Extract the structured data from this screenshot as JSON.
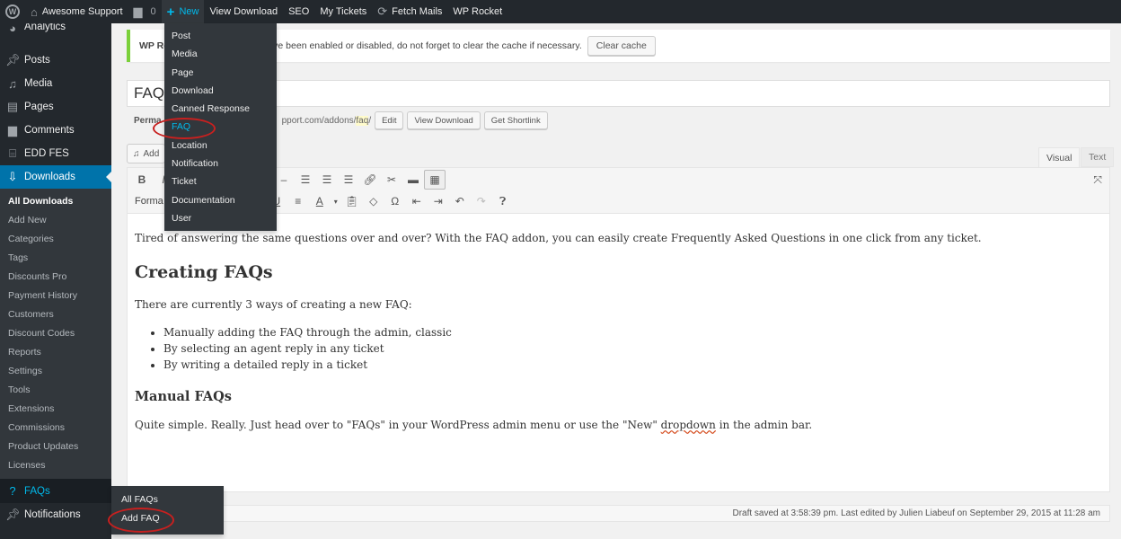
{
  "adminbar": {
    "site_name": "Awesome Support",
    "comment_count": "0",
    "new_label": "New",
    "items": [
      "View Download",
      "SEO",
      "My Tickets",
      "Fetch Mails",
      "WP Rocket"
    ]
  },
  "new_menu": {
    "items": [
      "Post",
      "Media",
      "Page",
      "Download",
      "Canned Response",
      "FAQ",
      "Location",
      "Notification",
      "Ticket",
      "Documentation",
      "User"
    ],
    "highlighted": "FAQ"
  },
  "sidebar": {
    "top_items": [
      {
        "label": "Analytics",
        "icon": "analytics-icon"
      },
      {
        "label": "Posts",
        "icon": "pin-icon"
      },
      {
        "label": "Media",
        "icon": "media-icon"
      },
      {
        "label": "Pages",
        "icon": "pages-icon"
      },
      {
        "label": "Comments",
        "icon": "comment-icon"
      },
      {
        "label": "EDD FES",
        "icon": "store-icon"
      },
      {
        "label": "Downloads",
        "icon": "download-icon"
      }
    ],
    "downloads_submenu": [
      "All Downloads",
      "Add New",
      "Categories",
      "Tags",
      "Discounts Pro",
      "Payment History",
      "Customers",
      "Discount Codes",
      "Reports",
      "Settings",
      "Tools",
      "Extensions",
      "Commissions",
      "Product Updates",
      "Licenses"
    ],
    "faqs_label": "FAQs",
    "notifications_label": "Notifications"
  },
  "faq_flyout": {
    "items": [
      "All FAQs",
      "Add FAQ"
    ]
  },
  "notice": {
    "prefix": "WP Ro",
    "text": "ons have been enabled or disabled, do not forget to clear the cache if necessary.",
    "button": "Clear cache"
  },
  "post": {
    "title": "FAQ",
    "permalink_label": "Perma",
    "permalink_url": "pport.com/addons/",
    "permalink_slug": "faq",
    "permalink_trail": "/",
    "edit_button": "Edit",
    "view_button": "View Download",
    "shortlink_button": "Get Shortlink",
    "add_media": "Add"
  },
  "editor": {
    "tab_visual": "Visual",
    "tab_text": "Text",
    "format_label": "Forma",
    "intro": "Tired of answering the same questions over and over? With the FAQ addon, you can easily create Frequently Asked Questions in one click from any ticket.",
    "h2": "Creating FAQs",
    "ways": "There are currently 3 ways of creating a new FAQ:",
    "list": [
      "Manually adding the FAQ through the admin, classic",
      "By selecting an agent reply in any ticket",
      "By writing a detailed reply in a ticket"
    ],
    "h3": "Manual FAQs",
    "manual_before": "Quite simple. Really. Just head over to \"FAQs\" in your WordPress admin menu or use the \"New\" ",
    "manual_spell": "dropdown",
    "manual_after": " in the admin bar."
  },
  "status": {
    "text": "Draft saved at 3:58:39 pm. Last edited by Julien Liabeuf on September 29, 2015 at 11:28 am"
  },
  "colors": {
    "adminbar_bg": "#23282d",
    "accent": "#0073aa",
    "highlight": "#00b9eb",
    "annotation": "#c8201f",
    "notice_border": "#7ad03a"
  }
}
